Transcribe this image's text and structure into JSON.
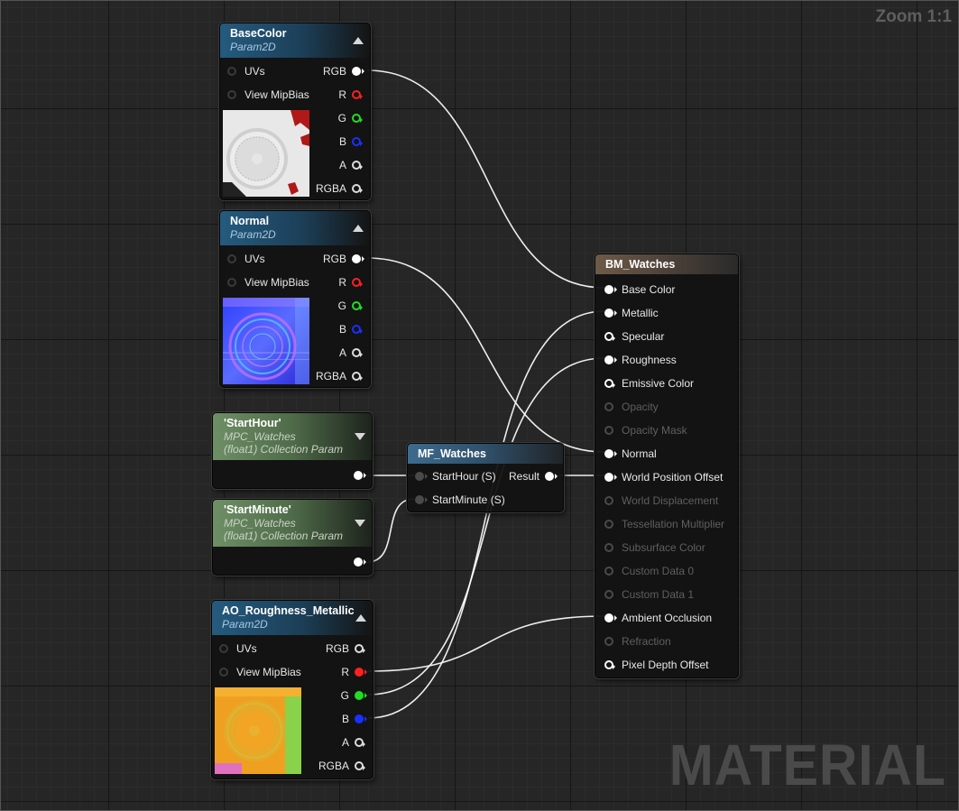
{
  "canvas": {
    "zoom_label": "Zoom 1:1",
    "watermark": "MATERIAL"
  },
  "colors": {
    "wire": "#ffffff",
    "pin_r": "#ff2020",
    "pin_g": "#22dd22",
    "pin_b": "#1a30ff",
    "pin_white": "#ffffff"
  },
  "nodes": {
    "basecolor": {
      "title": "BaseColor",
      "subtitle": "Param2D",
      "inputs": [
        "UVs",
        "View MipBias"
      ],
      "outputs": [
        "RGB",
        "R",
        "G",
        "B",
        "A",
        "RGBA"
      ],
      "preview": "clock-face-texture"
    },
    "normal": {
      "title": "Normal",
      "subtitle": "Param2D",
      "inputs": [
        "UVs",
        "View MipBias"
      ],
      "outputs": [
        "RGB",
        "R",
        "G",
        "B",
        "A",
        "RGBA"
      ],
      "preview": "normal-map-texture"
    },
    "starthour": {
      "title": "'StartHour'",
      "line1": "MPC_Watches",
      "line2": "(float1) Collection Param"
    },
    "startminute": {
      "title": "'StartMinute'",
      "line1": "MPC_Watches",
      "line2": "(float1) Collection Param"
    },
    "ao": {
      "title": "AO_Roughness_Metallic",
      "subtitle": "Param2D",
      "inputs": [
        "UVs",
        "View MipBias"
      ],
      "outputs": [
        "RGB",
        "R",
        "G",
        "B",
        "A",
        "RGBA"
      ],
      "preview": "orm-texture"
    },
    "mf_watches": {
      "title": "MF_Watches",
      "inputs": [
        "StartHour (S)",
        "StartMinute (S)"
      ],
      "output": "Result"
    },
    "bm_watches": {
      "title": "BM_Watches",
      "inputs": [
        {
          "label": "Base Color",
          "state": "connected"
        },
        {
          "label": "Metallic",
          "state": "connected"
        },
        {
          "label": "Specular",
          "state": "open"
        },
        {
          "label": "Roughness",
          "state": "connected"
        },
        {
          "label": "Emissive Color",
          "state": "open"
        },
        {
          "label": "Opacity",
          "state": "disabled"
        },
        {
          "label": "Opacity Mask",
          "state": "disabled"
        },
        {
          "label": "Normal",
          "state": "connected"
        },
        {
          "label": "World Position Offset",
          "state": "connected"
        },
        {
          "label": "World Displacement",
          "state": "disabled"
        },
        {
          "label": "Tessellation Multiplier",
          "state": "disabled"
        },
        {
          "label": "Subsurface Color",
          "state": "disabled"
        },
        {
          "label": "Custom Data 0",
          "state": "disabled"
        },
        {
          "label": "Custom Data 1",
          "state": "disabled"
        },
        {
          "label": "Ambient Occlusion",
          "state": "connected"
        },
        {
          "label": "Refraction",
          "state": "disabled"
        },
        {
          "label": "Pixel Depth Offset",
          "state": "open"
        }
      ]
    }
  }
}
